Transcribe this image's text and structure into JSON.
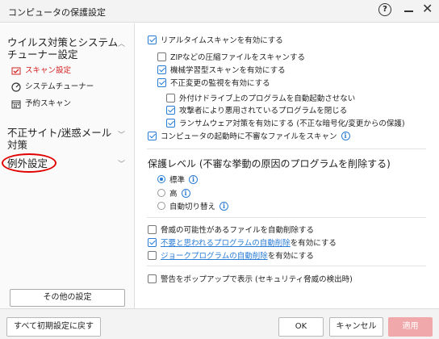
{
  "window": {
    "title": "コンピュータの保護設定"
  },
  "sidebar": {
    "sections": [
      {
        "label": "ウイルス対策とシステムチューナー設定"
      },
      {
        "label": "不正サイト/迷惑メール対策"
      },
      {
        "label": "例外設定"
      }
    ],
    "items": [
      {
        "label": "スキャン設定"
      },
      {
        "label": "システムチューナー"
      },
      {
        "label": "予約スキャン"
      }
    ],
    "other_button": "その他の設定"
  },
  "scan": {
    "realtime": "リアルタイムスキャンを有効にする",
    "zip": "ZIPなどの圧縮ファイルをスキャンする",
    "ml": "機械学習型スキャンを有効にする",
    "monitor": "不正変更の監視を有効にする",
    "external": "外付けドライブ上のプログラムを自動起動させない",
    "attacker": "攻撃者により悪用されているプログラムを閉じる",
    "ransom": "ランサムウェア対策を有効にする (不正な暗号化/変更からの保護)",
    "startup": "コンピュータの起動時に不審なファイルをスキャン"
  },
  "protection": {
    "title": "保護レベル (不審な挙動の原因のプログラムを削除する)",
    "options": [
      "標準",
      "高",
      "自動切り替え"
    ]
  },
  "options": {
    "auto_delete": "脅威の可能性があるファイルを自動削除する",
    "pup_link": "不要と思われるプログラムの自動削除",
    "pup_suffix": "を有効にする",
    "joke_link": "ジョークプログラムの自動削除",
    "joke_suffix": "を有効にする",
    "popup": "警告をポップアップで表示 (セキュリティ脅威の検出時)"
  },
  "footer": {
    "reset": "すべて初期設定に戻す",
    "ok": "OK",
    "cancel": "キャンセル",
    "apply": "適用"
  },
  "colors": {
    "accent": "#2a7bd4",
    "active": "#d32020",
    "apply_disabled": "#f0a8aa",
    "annotation": "#e00000"
  }
}
